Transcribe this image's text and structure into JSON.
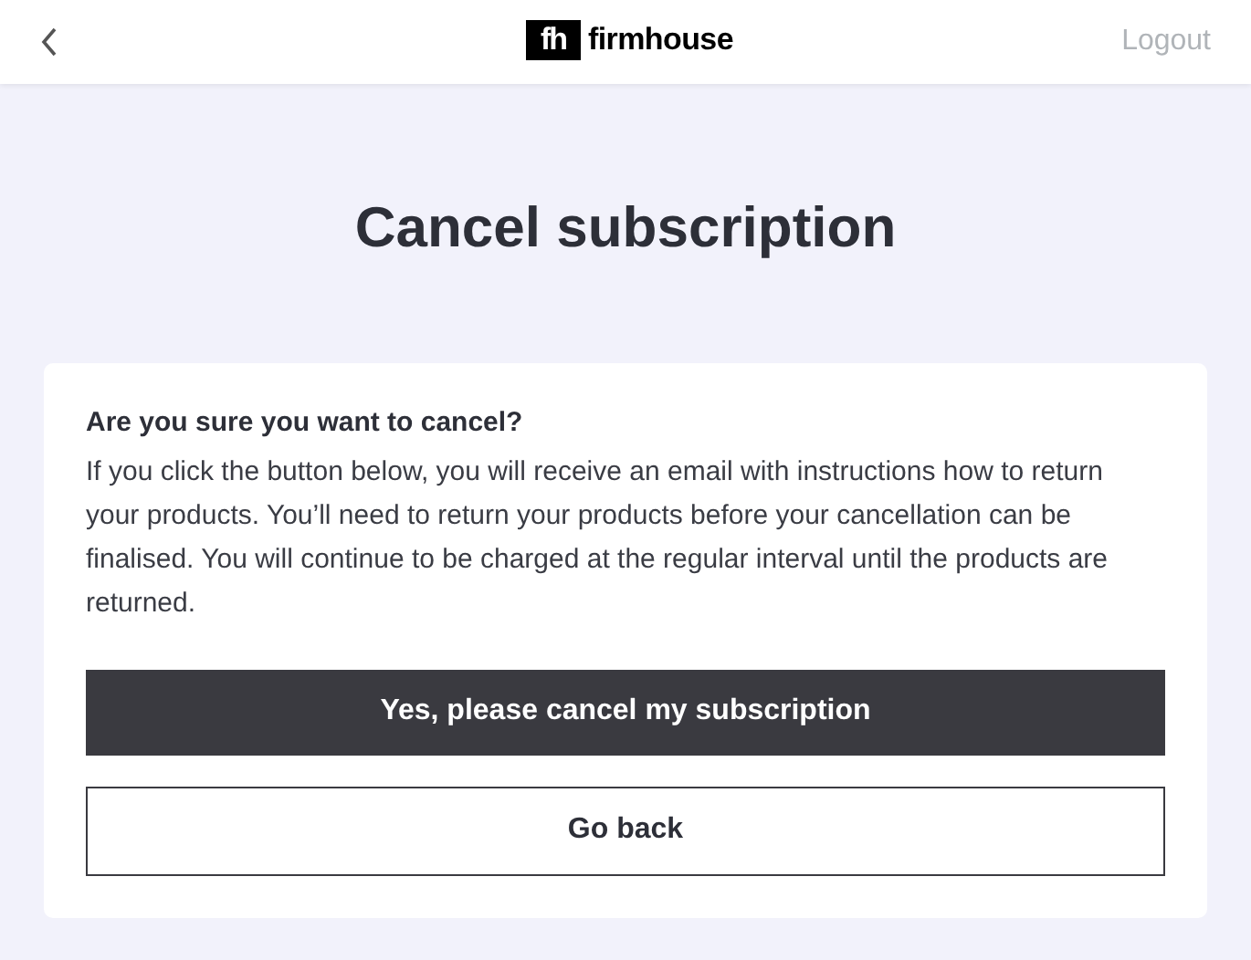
{
  "header": {
    "logo_mark": "fh",
    "logo_text": "firmhouse",
    "logout": "Logout"
  },
  "title": "Cancel subscription",
  "card": {
    "heading": "Are you sure you want to cancel?",
    "body": "If you click the button below, you will receive an email with instructions how to return your products. You’ll need to return your products before your cancellation can be finalised. You will continue to be charged at the regular interval until the products are returned.",
    "buttons": [
      {
        "label": "Yes, please cancel my subscription",
        "kind": "primary"
      },
      {
        "label": "Go back",
        "kind": "secondary"
      }
    ]
  }
}
